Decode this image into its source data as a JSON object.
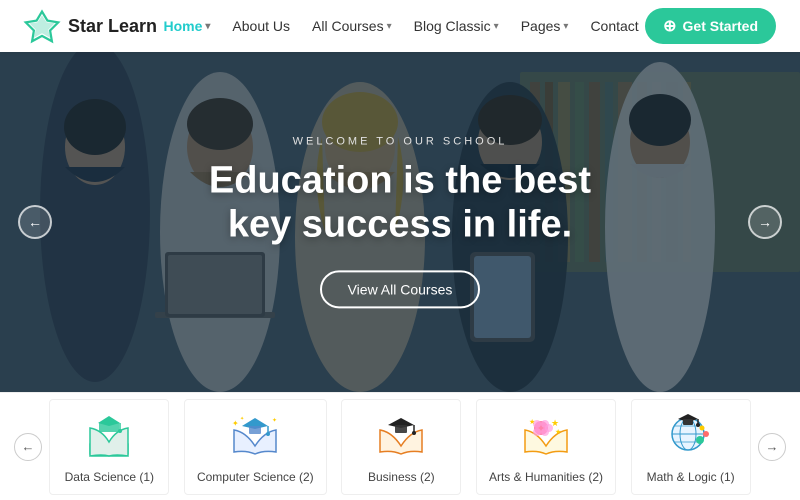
{
  "logo": {
    "text": "Star Learn",
    "icon_color": "#2bc89a"
  },
  "navbar": {
    "links": [
      {
        "label": "Home",
        "active": true,
        "has_dropdown": true
      },
      {
        "label": "About Us",
        "active": false,
        "has_dropdown": false
      },
      {
        "label": "All Courses",
        "active": false,
        "has_dropdown": true
      },
      {
        "label": "Blog Classic",
        "active": false,
        "has_dropdown": true
      },
      {
        "label": "Pages",
        "active": false,
        "has_dropdown": true
      },
      {
        "label": "Contact",
        "active": false,
        "has_dropdown": false
      }
    ],
    "cta_label": "Get Started"
  },
  "hero": {
    "subtitle": "WELCOME TO OUR SCHOOL",
    "title": "Education is the best key success in life.",
    "cta_label": "View All Courses"
  },
  "categories": {
    "items": [
      {
        "label": "Data Science (1)",
        "icon": "data-science"
      },
      {
        "label": "Computer Science (2)",
        "icon": "computer-science"
      },
      {
        "label": "Business (2)",
        "icon": "business"
      },
      {
        "label": "Arts & Humanities (2)",
        "icon": "arts"
      },
      {
        "label": "Math & Logic (1)",
        "icon": "math"
      }
    ]
  }
}
